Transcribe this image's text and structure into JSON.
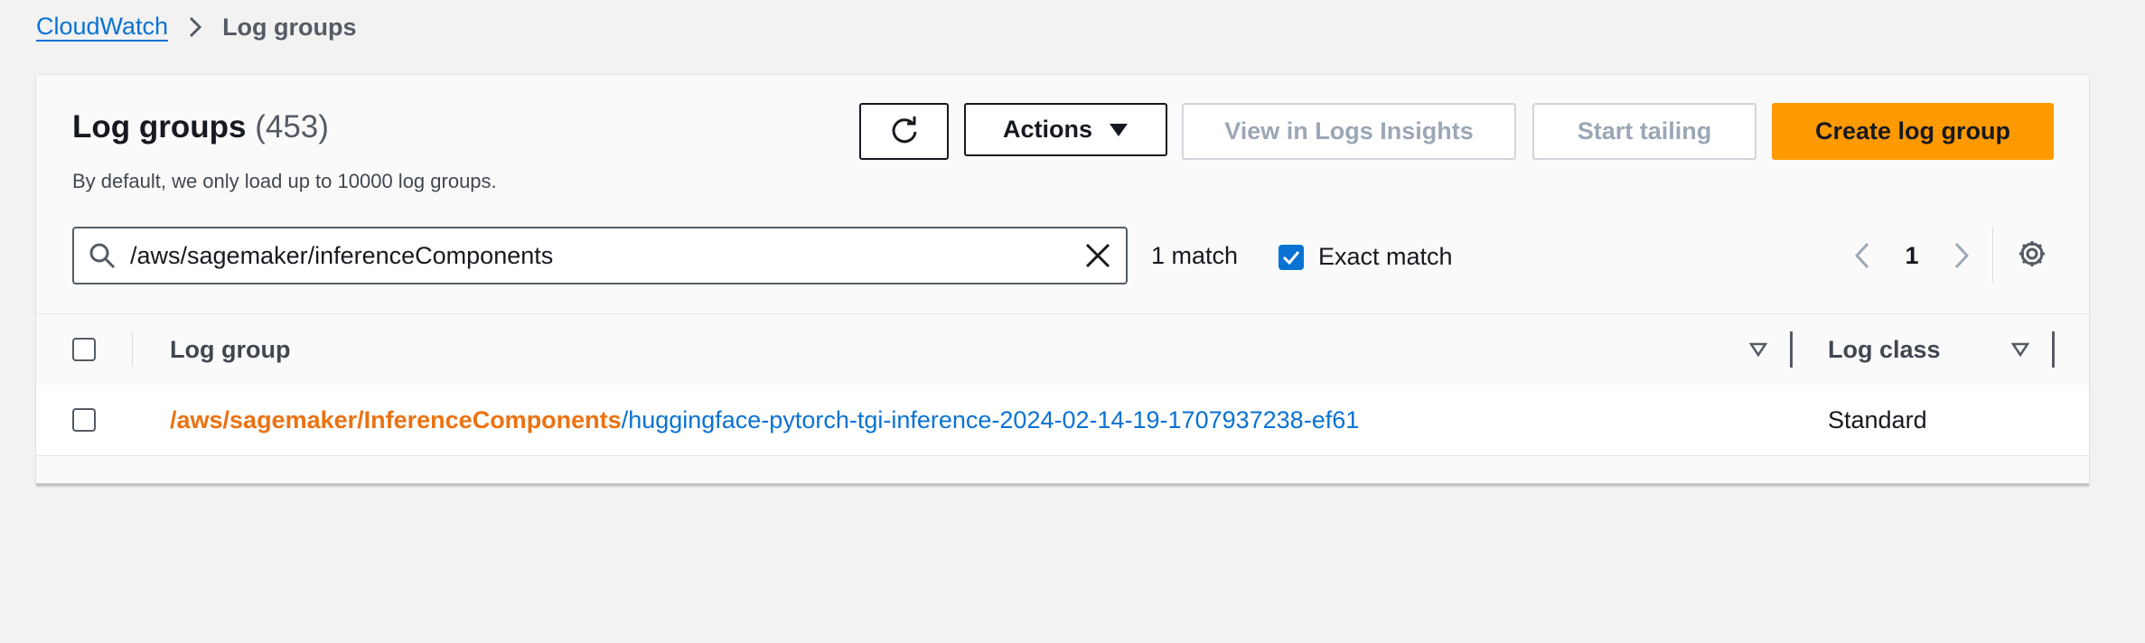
{
  "breadcrumb": {
    "root": "CloudWatch",
    "current": "Log groups"
  },
  "panel": {
    "title": "Log groups",
    "count": "(453)",
    "description": "By default, we only load up to 10000 log groups."
  },
  "toolbar": {
    "refresh_icon": "refresh-icon",
    "actions_label": "Actions",
    "view_insights_label": "View in Logs Insights",
    "start_tailing_label": "Start tailing",
    "create_label": "Create log group"
  },
  "filter": {
    "value": "/aws/sagemaker/inferenceComponents",
    "match_text": "1 match",
    "exact_match_label": "Exact match",
    "exact_match_checked": true
  },
  "pagination": {
    "current_page": "1"
  },
  "table": {
    "columns": [
      "Log group",
      "Log class"
    ],
    "rows": [
      {
        "log_group_match": "/aws/sagemaker/InferenceComponents",
        "log_group_rest": "/huggingface-pytorch-tgi-inference-2024-02-14-19-1707937238-ef61",
        "log_class": "Standard"
      }
    ]
  },
  "colors": {
    "link": "#0972d3",
    "highlight": "#ec7211",
    "primary_button": "#ff9900",
    "background": "#f2f2f2"
  }
}
